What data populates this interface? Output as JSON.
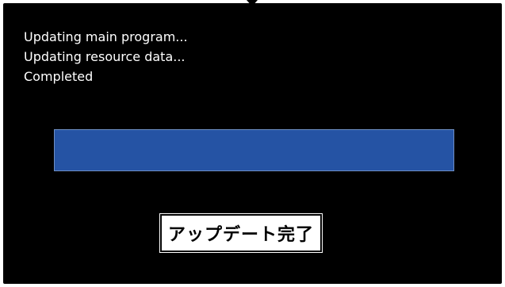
{
  "log": {
    "lines": [
      "Updating main program...",
      "Updating resource data...",
      "Completed"
    ]
  },
  "progress": {
    "fraction": 1.0,
    "fill_color": "#2553a4",
    "border_color": "#6f8fc4"
  },
  "status": {
    "label": "アップデート完了"
  },
  "colors": {
    "screen_background": "#000000",
    "text": "#ffffff"
  }
}
